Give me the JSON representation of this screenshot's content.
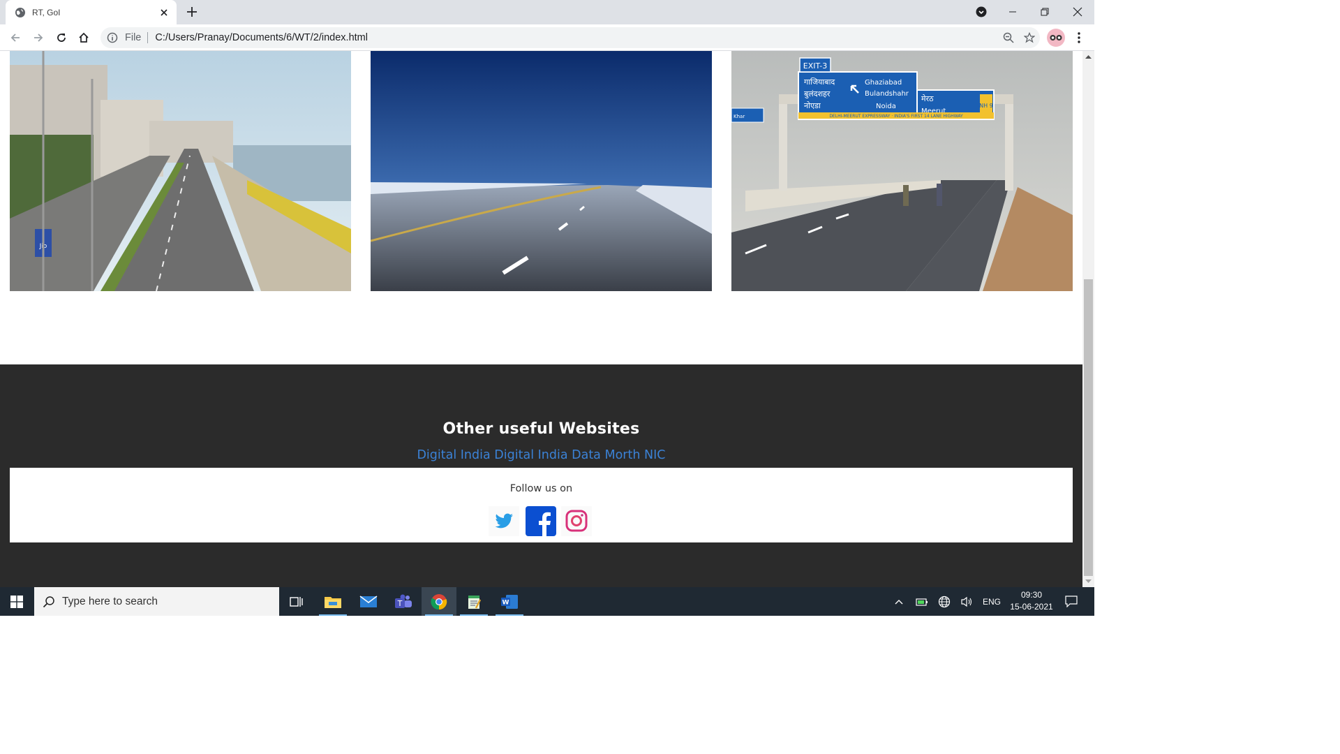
{
  "browser": {
    "tab_title": "RT, GoI",
    "address_scheme": "File",
    "address_url": "C:/Users/Pranay/Documents/6/WT/2/index.html"
  },
  "page": {
    "photos": [
      {
        "alt": "Marine Drive road"
      },
      {
        "alt": "Empty highway under blue sky"
      },
      {
        "alt": "Delhi-Meerut Expressway"
      }
    ],
    "signboard": {
      "exit": "EXIT-3",
      "lines_hindi": [
        "गाजियाबाद",
        "बुलंदशहर",
        "नोएडा"
      ],
      "lines_english": [
        "Ghaziabad",
        "Bulandshahr",
        "Noida"
      ],
      "right_hindi": "मेरठ",
      "right_english": "Meerut",
      "nh": "NH 9",
      "banner": "DELHI-MEERUT EXPRESSWAY · INDIA'S FIRST 14 LANE HIGHWAY",
      "left_small": "Khar"
    },
    "footer": {
      "heading": "Other useful Websites",
      "links": [
        "Digital India",
        "Digital India Data",
        "Morth",
        "NIC"
      ],
      "follow_label": "Follow us on",
      "social": [
        "twitter",
        "facebook",
        "instagram"
      ]
    }
  },
  "taskbar": {
    "search_placeholder": "Type here to search",
    "lang": "ENG",
    "time": "09:30",
    "date": "15-06-2021"
  },
  "colors": {
    "footer_bg": "#2b2b2b",
    "link": "#3b82d6",
    "taskbar": "#1f2933"
  }
}
